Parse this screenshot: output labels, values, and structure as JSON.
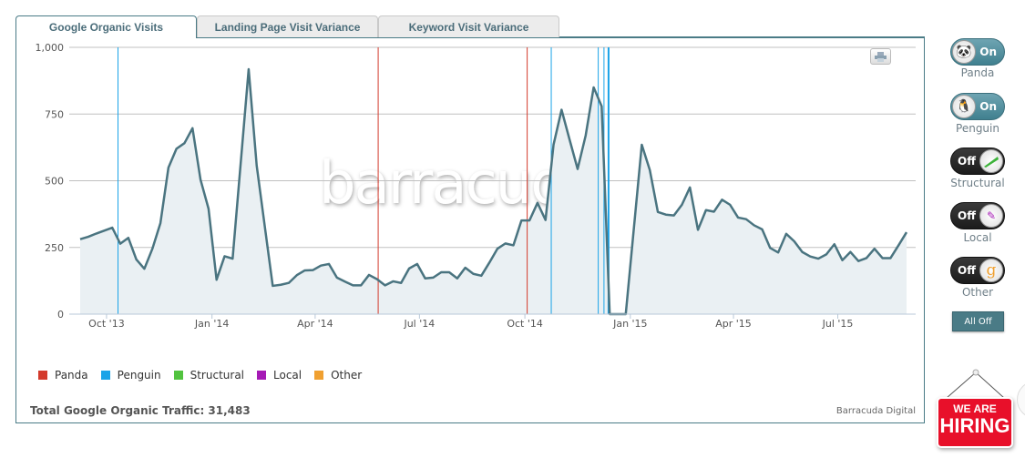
{
  "tabs": [
    {
      "label": "Google Organic Visits",
      "active": true
    },
    {
      "label": "Landing Page Visit Variance",
      "active": false
    },
    {
      "label": "Keyword Visit Variance",
      "active": false
    }
  ],
  "watermark": "barracuda",
  "print_icon": "printer-icon",
  "chart_data": {
    "type": "area",
    "title": "",
    "xlabel": "",
    "ylabel": "",
    "ylim": [
      0,
      1000
    ],
    "yticks": [
      "0",
      "250",
      "500",
      "750",
      "1,000"
    ],
    "ytick_values": [
      0,
      250,
      500,
      750,
      1000
    ],
    "xticks": [
      {
        "label": "Oct '13",
        "date": "2013-10-01"
      },
      {
        "label": "Jan '14",
        "date": "2014-01-01"
      },
      {
        "label": "Apr '14",
        "date": "2014-04-01"
      },
      {
        "label": "Jul '14",
        "date": "2014-07-01"
      },
      {
        "label": "Oct '14",
        "date": "2014-10-01"
      },
      {
        "label": "Jan '15",
        "date": "2015-01-01"
      },
      {
        "label": "Apr '15",
        "date": "2015-04-01"
      },
      {
        "label": "Jul '15",
        "date": "2015-07-01"
      }
    ],
    "grid": true,
    "line_color": "#4a7480",
    "fill_color": "#eaf0f3",
    "x": [
      "2013-09-08",
      "2013-09-15",
      "2013-09-22",
      "2013-09-29",
      "2013-10-06",
      "2013-10-13",
      "2013-10-20",
      "2013-10-27",
      "2013-11-03",
      "2013-11-10",
      "2013-11-17",
      "2013-11-24",
      "2013-12-01",
      "2013-12-08",
      "2013-12-15",
      "2013-12-22",
      "2013-12-29",
      "2014-01-05",
      "2014-01-12",
      "2014-01-19",
      "2014-01-26",
      "2014-02-02",
      "2014-02-09",
      "2014-02-16",
      "2014-02-23",
      "2014-03-02",
      "2014-03-09",
      "2014-03-16",
      "2014-03-23",
      "2014-03-30",
      "2014-04-06",
      "2014-04-13",
      "2014-04-20",
      "2014-04-27",
      "2014-05-04",
      "2014-05-11",
      "2014-05-18",
      "2014-05-25",
      "2014-06-01",
      "2014-06-08",
      "2014-06-15",
      "2014-06-22",
      "2014-06-29",
      "2014-07-06",
      "2014-07-13",
      "2014-07-20",
      "2014-07-27",
      "2014-08-03",
      "2014-08-10",
      "2014-08-17",
      "2014-08-24",
      "2014-08-31",
      "2014-09-07",
      "2014-09-14",
      "2014-09-21",
      "2014-09-28",
      "2014-10-05",
      "2014-10-12",
      "2014-10-19",
      "2014-10-26",
      "2014-11-02",
      "2014-11-09",
      "2014-11-16",
      "2014-11-23",
      "2014-11-30",
      "2014-12-07",
      "2014-12-14",
      "2014-12-21",
      "2014-12-28",
      "2015-01-04",
      "2015-01-11",
      "2015-01-18",
      "2015-01-25",
      "2015-02-01",
      "2015-02-08",
      "2015-02-15",
      "2015-02-22",
      "2015-03-01",
      "2015-03-08",
      "2015-03-15",
      "2015-03-22",
      "2015-03-29",
      "2015-04-05",
      "2015-04-12",
      "2015-04-19",
      "2015-04-26",
      "2015-05-03",
      "2015-05-10",
      "2015-05-17",
      "2015-05-24",
      "2015-05-31",
      "2015-06-07",
      "2015-06-14",
      "2015-06-21",
      "2015-06-28",
      "2015-07-05",
      "2015-07-12",
      "2015-07-19",
      "2015-07-26",
      "2015-08-02",
      "2015-08-09",
      "2015-08-16",
      "2015-08-23",
      "2015-08-30"
    ],
    "values": [
      281,
      290,
      302,
      313,
      324,
      264,
      286,
      205,
      170,
      245,
      341,
      549,
      620,
      641,
      697,
      504,
      395,
      129,
      217,
      208,
      563,
      918,
      557,
      331,
      106,
      110,
      117,
      146,
      164,
      165,
      182,
      188,
      137,
      122,
      108,
      108,
      147,
      131,
      108,
      123,
      117,
      171,
      188,
      134,
      137,
      157,
      157,
      134,
      174,
      151,
      144,
      193,
      245,
      265,
      258,
      351,
      351,
      417,
      353,
      635,
      766,
      654,
      544,
      669,
      850,
      779,
      0,
      0,
      0,
      318,
      635,
      540,
      383,
      373,
      370,
      410,
      475,
      316,
      390,
      384,
      429,
      410,
      362,
      356,
      333,
      318,
      248,
      231,
      301,
      273,
      233,
      216,
      208,
      224,
      262,
      202,
      233,
      199,
      210,
      245,
      210,
      210,
      258,
      307
    ],
    "events": [
      {
        "type": "Penguin",
        "date": "2013-10-11"
      },
      {
        "type": "Panda",
        "date": "2014-05-26"
      },
      {
        "type": "Panda",
        "date": "2014-10-03"
      },
      {
        "type": "Penguin",
        "date": "2014-10-24"
      },
      {
        "type": "Penguin",
        "date": "2014-12-04"
      },
      {
        "type": "Penguin",
        "date": "2014-12-09"
      },
      {
        "type": "Penguin",
        "date": "2014-12-13"
      }
    ],
    "legend_position": "bottom-left"
  },
  "legend": [
    {
      "label": "Panda",
      "color": "#d33a2c"
    },
    {
      "label": "Penguin",
      "color": "#1aa3e8"
    },
    {
      "label": "Structural",
      "color": "#52c33f"
    },
    {
      "label": "Local",
      "color": "#a51ab5"
    },
    {
      "label": "Other",
      "color": "#f0a030"
    }
  ],
  "total": "Total Google Organic Traffic: 31,483",
  "credit": "Barracuda Digital",
  "toggles": [
    {
      "label": "Panda",
      "state": "On",
      "icon": "panda-icon"
    },
    {
      "label": "Penguin",
      "state": "On",
      "icon": "penguin-icon"
    },
    {
      "label": "Structural",
      "state": "Off",
      "icon": "structural-beam-icon"
    },
    {
      "label": "Local",
      "state": "Off",
      "icon": "pigeon-icon"
    },
    {
      "label": "Other",
      "state": "Off",
      "icon": "google-g-icon"
    }
  ],
  "all_off": "All Off",
  "hiring": {
    "line1": "WE ARE",
    "line2": "HIRING"
  }
}
